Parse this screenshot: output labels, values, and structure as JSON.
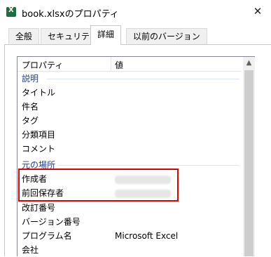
{
  "window": {
    "title": "book.xlsxのプロパティ",
    "close_label": "✕"
  },
  "tabs": [
    {
      "label": "全般"
    },
    {
      "label": "セキュリティ"
    },
    {
      "label": "詳細"
    },
    {
      "label": "以前のバージョン"
    }
  ],
  "active_tab": "詳細",
  "list": {
    "columns": [
      "プロパティ",
      "値"
    ],
    "groups": [
      {
        "label": "説明"
      },
      {
        "label": "元の場所"
      }
    ],
    "rows": [
      {
        "name": "タイトル",
        "value": ""
      },
      {
        "name": "件名",
        "value": ""
      },
      {
        "name": "タグ",
        "value": ""
      },
      {
        "name": "分類項目",
        "value": ""
      },
      {
        "name": "コメント",
        "value": ""
      },
      {
        "name": "作成者",
        "value": ""
      },
      {
        "name": "前回保存者",
        "value": ""
      },
      {
        "name": "改訂番号",
        "value": ""
      },
      {
        "name": "バージョン番号",
        "value": ""
      },
      {
        "name": "プログラム名",
        "value": "Microsoft Excel"
      },
      {
        "name": "会社",
        "value": ""
      }
    ]
  },
  "icons": {
    "app": "excel-file-icon",
    "scroll_up": "chevron-up-icon"
  },
  "colors": {
    "group_label": "#1f3f9b",
    "highlight_border": "#e00000"
  }
}
